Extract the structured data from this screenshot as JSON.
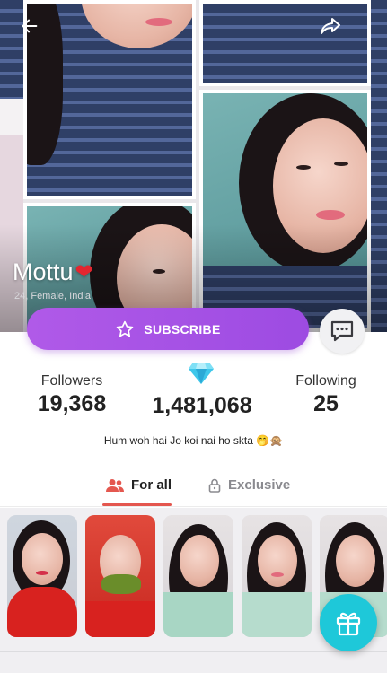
{
  "profile": {
    "name": "Mottu",
    "meta": "24, Female, India"
  },
  "actions": {
    "subscribe_label": "SUBSCRIBE"
  },
  "stats": {
    "followers_label": "Followers",
    "followers_value": "19,368",
    "diamonds_value": "1,481,068",
    "following_label": "Following",
    "following_value": "25"
  },
  "bio": "Hum woh hai Jo koi nai ho skta 🤭🙊",
  "tabs": {
    "for_all": "For all",
    "exclusive": "Exclusive"
  },
  "colors": {
    "subscribe": "#a653e5",
    "gift": "#1ec8d9",
    "tab_accent": "#e4574f"
  }
}
